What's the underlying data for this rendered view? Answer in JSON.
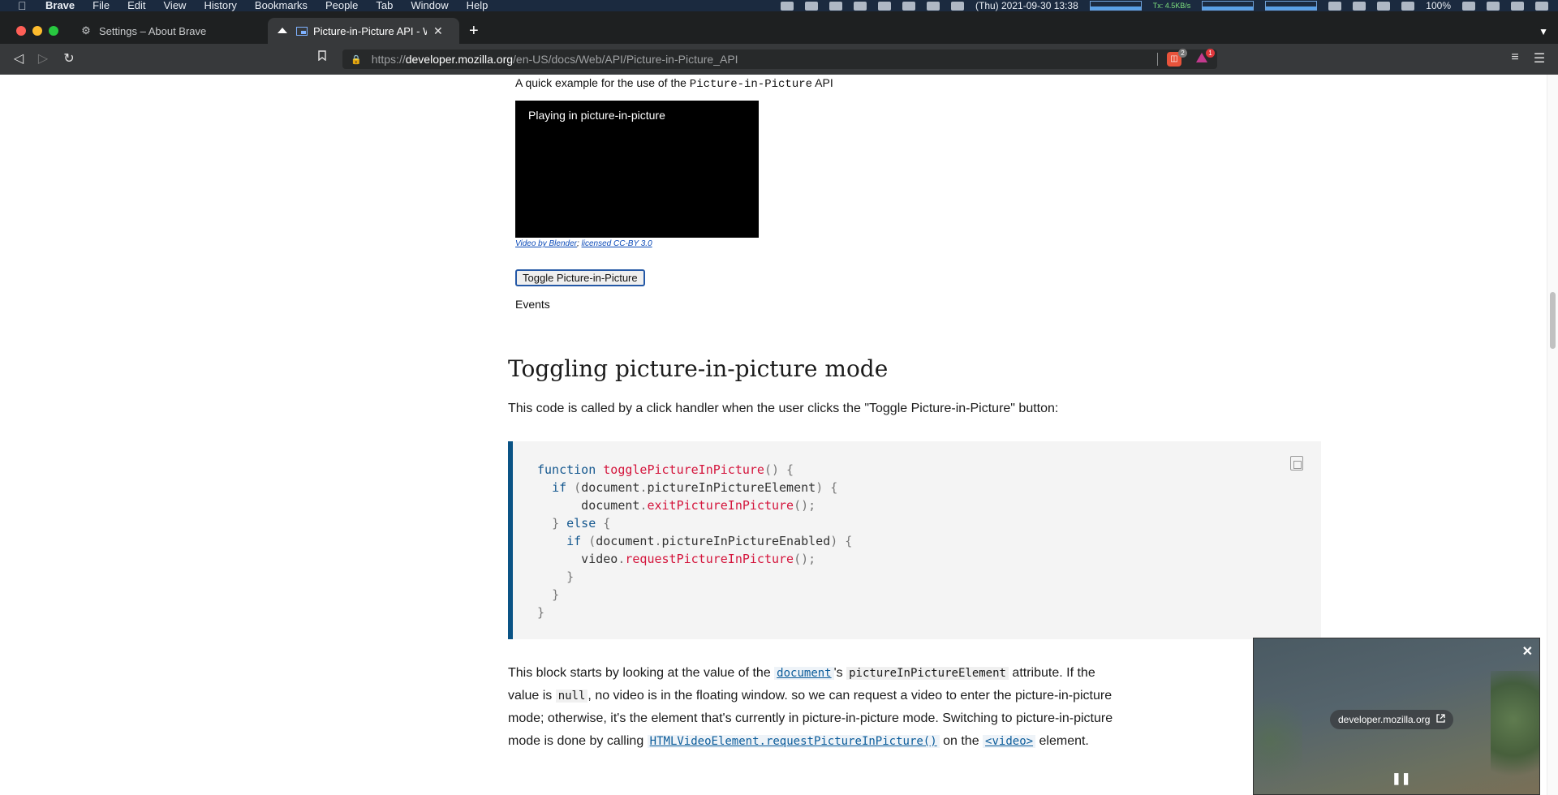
{
  "menubar": {
    "app_name": "Brave",
    "items": [
      "File",
      "Edit",
      "View",
      "History",
      "Bookmarks",
      "People",
      "Tab",
      "Window",
      "Help"
    ],
    "clock": "(Thu) 2021-09-30 13:38",
    "net_label": "Tx:",
    "net_rate": "4.5KB/s",
    "battery": "100%"
  },
  "tabs": [
    {
      "title": "Settings – About Brave",
      "icon": "gear-icon"
    },
    {
      "title": "Picture-in-Picture API - Web",
      "icon": "mdn-icon"
    }
  ],
  "toolbar": {
    "url_scheme": "https://",
    "url_host": "developer.mozilla.org",
    "url_path": "/en-US/docs/Web/API/Picture-in-Picture_API",
    "shields_count": "2",
    "rewards_count": "1"
  },
  "content": {
    "example_caption_pre": "A quick example for the use of the ",
    "example_caption_code": "Picture-in-Picture",
    "example_caption_post": " API",
    "video_text": "Playing in picture-in-picture",
    "credit_link1": "Video by Blender",
    "credit_sep": "; ",
    "credit_link2": "licensed CC-BY 3.0",
    "toggle_button": "Toggle Picture-in-Picture",
    "events_label": "Events",
    "section_heading": "Toggling picture-in-picture mode",
    "intro": "This code is called by a click handler when the user clicks the \"Toggle Picture-in-Picture\" button:",
    "code_lines": [
      "function togglePictureInPicture() {",
      "  if (document.pictureInPictureElement) {",
      "      document.exitPictureInPicture();",
      "  } else {",
      "    if (document.pictureInPictureEnabled) {",
      "      video.requestPictureInPicture();",
      "    }",
      "  }",
      "}"
    ],
    "para": {
      "t1": "This block starts by looking at the value of the ",
      "link_document": "document",
      "t2": "'s ",
      "code_ppe": "pictureInPictureElement",
      "t3": " attribute. If the value is ",
      "code_null": "null",
      "t4": ", no video is in the floating window. so we can request a video to enter the picture-in-picture mode; otherwise, it's the element that's currently in picture-in-picture mode. Switching to picture-in-picture mode is done by calling ",
      "link_request": "HTMLVideoElement.requestPictureInPicture()",
      "t5": " on the ",
      "link_video": "<video>",
      "t6": " element."
    }
  },
  "pip": {
    "origin": "developer.mozilla.org"
  },
  "colors": {
    "code_accent": "#0a5385",
    "code_keyword": "#15588f",
    "code_function": "#d4153c"
  }
}
